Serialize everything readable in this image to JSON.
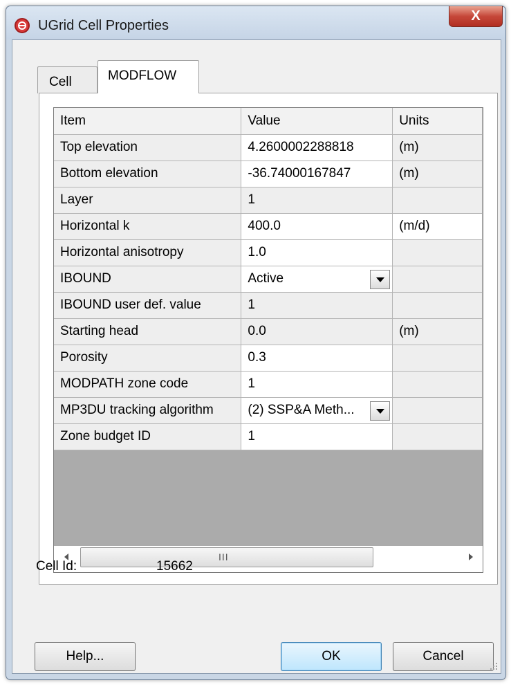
{
  "window": {
    "title": "UGrid Cell Properties",
    "close_label": "X"
  },
  "tabs": [
    {
      "label": "Cell",
      "selected": false
    },
    {
      "label": "MODFLOW",
      "selected": true
    }
  ],
  "grid": {
    "headers": [
      "Item",
      "Value",
      "Units"
    ],
    "rows": [
      {
        "item": "Top elevation",
        "value": "4.2600002288818",
        "units": "(m)"
      },
      {
        "item": "Bottom elevation",
        "value": "-36.74000167847",
        "units": "(m)"
      },
      {
        "item": "Layer",
        "value": "1",
        "units": ""
      },
      {
        "item": "Horizontal k",
        "value": "400.0",
        "units": "(m/d)"
      },
      {
        "item": "Horizontal anisotropy",
        "value": "1.0",
        "units": ""
      },
      {
        "item": "IBOUND",
        "value": "Active",
        "units": ""
      },
      {
        "item": "IBOUND user def. value",
        "value": "1",
        "units": ""
      },
      {
        "item": "Starting head",
        "value": "0.0",
        "units": "(m)"
      },
      {
        "item": "Porosity",
        "value": "0.3",
        "units": ""
      },
      {
        "item": "MODPATH zone code",
        "value": "1",
        "units": ""
      },
      {
        "item": "MP3DU tracking algorithm",
        "value": "(2) SSP&A Meth...",
        "units": ""
      },
      {
        "item": "Zone budget ID",
        "value": "1",
        "units": ""
      }
    ],
    "scrollbar_grip": "III"
  },
  "cell_id": {
    "label": "Cell Id:",
    "value": "15662"
  },
  "buttons": {
    "help": "Help...",
    "ok": "OK",
    "cancel": "Cancel"
  }
}
